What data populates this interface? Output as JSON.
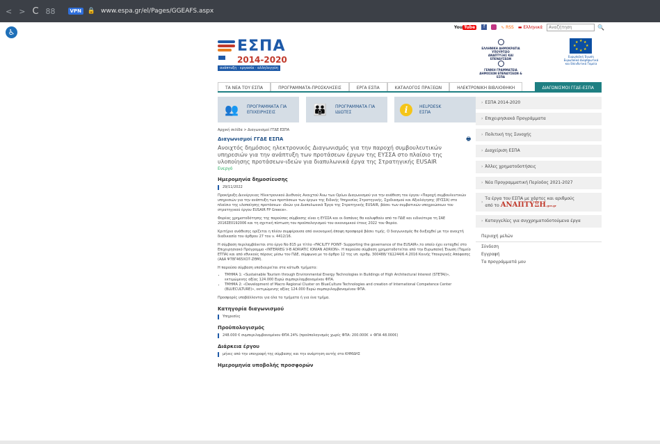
{
  "browser": {
    "back": "<",
    "forward": ">",
    "reload": "C",
    "apps": "88",
    "vpn": "VPN",
    "url": "www.espa.gr/el/Pages/GGEAFS.aspx"
  },
  "topbar": {
    "youtube": "You",
    "youtube_tube": "Tube",
    "rss": "RSS",
    "language": "Ελληνικά",
    "search_placeholder": "Αναζήτηση"
  },
  "logo": {
    "word": "ΕΣΠΑ",
    "years": "2014-2020",
    "tagline": "ανάπτυξη · εργασία · αλληλεγγύη"
  },
  "gov": {
    "l1": "ΕΛΛΗΝΙΚΗ ΔΗΜΟΚΡΑΤΙΑ",
    "l2": "ΥΠΟΥΡΓΕΙΟ",
    "l3": "ΑΝΑΠΤΥΞΗΣ ΚΑΙ ΕΠΕΝΔΥΣΕΩΝ",
    "l4": "ΓΕΝΙΚΗ ΓΡΑΜΜΑΤΕΙΑ",
    "l5": "ΔΗΜΟΣΙΩΝ ΕΠΕΝΔΥΣΕΩΝ & ΕΣΠΑ"
  },
  "eu": {
    "l1": "Ευρωπαϊκή Ένωση",
    "l2": "Ευρωπαϊκά Διαρθρωτικά",
    "l3": "και Επενδυτικά Ταμεία"
  },
  "menu": [
    "ΤΑ ΝΕΑ ΤΟΥ ΕΣΠΑ",
    "ΠΡΟΓΡΑΜΜΑΤΑ-ΠΡΟΣΚΛΗΣΕΙΣ",
    "ΕΡΓΑ ΕΣΠΑ",
    "ΚΑΤΑΛΟΓΟΣ ΠΡΑΞΕΩΝ",
    "ΗΛΕΚΤΡΟΝΙΚΗ ΒΙΒΛΙΟΘΗΚΗ",
    "ΔΙΑΓΩΝΙΣΜΟΙ ΓΓΔΕ-ΕΣΠΑ"
  ],
  "tiles": [
    {
      "line1": "ΠΡΟΓΡΑΜΜΑΤΑ ΓΙΑ",
      "line2": "ΕΠΙΧΕΙΡΗΣΕΙΣ"
    },
    {
      "line1": "ΠΡΟΓΡΑΜΜΑΤΑ ΓΙΑ",
      "line2": "ΙΔΙΩΤΕΣ"
    },
    {
      "line1": "HELPDESK",
      "line2": "ΕΣΠΑ",
      "icon": "i"
    }
  ],
  "sidebar": {
    "items": [
      "ΕΣΠΑ 2014-2020",
      "Επιχειρησιακά Προγράμματα",
      "Πολιτική της Συνοχής",
      "Διαχείριση ΕΣΠΑ",
      "Άλλες χρηματοδοτήσεις",
      "Νέα Προγραμματική Περίοδος 2021-2027"
    ],
    "tall_line1": "Τα έργα του ΕΣΠΑ με χάρτες και αριθμούς",
    "tall_line2_prefix": "από το",
    "tall_brand": "ΑΝΑΠΤΥΞΗ",
    "tall_brand_suffix": ".gov.gr",
    "last": "Καταγγελίες για συγχρηματοδοτούμενα έργα",
    "user_header": "Περιοχή μελών",
    "user_links": [
      "Σύνδεση",
      "Εγγραφή",
      "Τα προγράμματά μου"
    ]
  },
  "content": {
    "breadcrumb": "Αρχική σελίδα > Διαγωνισμοί ΓΓΔΕ ΕΣΠΑ",
    "title": "Διαγωνισμοί ΓΓΔΕ ΕΣΠΑ",
    "print": "🖶",
    "lead": "Ανοιχτός δημόσιος ηλεκτρονικός Διαγωνισμός για την παροχή συμβουλευτικών υπηρεσιών για την ανάπτυξη των προτάσεων έργων της ΕΥΣΣΑ στο πλαίσιο της υλοποίησης προτάσεων-ιδεών για διαπυλωνικά έργα της Στρατηγικής EUSAIR",
    "status": "Ενεργό",
    "date_header": "Ημερομηνία δημοσίευσης",
    "date": "29/11/2022",
    "p1": "Προκήρυξη Διενέργειας Ηλεκτρονικού Διεθνούς Ανοιχτού Άνω των Ορίων Διαγωνισμού για την ανάθεση του έργου «Παροχή συμβουλευτικών υπηρεσιών για την ανάπτυξη των προτάσεων των έργων της Ειδικής Υπηρεσίας Στρατηγικής, Σχεδιασμού και Αξιολόγησης (ΕΥΣΣΑ) στο πλαίσιο της υλοποίησης προτάσεων- ιδεών για Διαπυλωνικά Έργα της Στρατηγικής EUSAIR, βάσει των συμβατικών υποχρεώσεων του στρατηγικού έργου EUSAIR FP Greece».",
    "p2": "Φορέας χρηματοδότησης της παρούσας σύμβασης είναι η ΕΥΣΣΑ και οι δαπάνες θα καλυφθούν από το ΠΔΕ και ειδικότερα τη ΣΑΕ 2016ΣΕ0192006 και τη σχετική πίστωση του προϋπολογισμού του οικονομικού έτους 2022 του Φορέα.",
    "p3": "Κριτήριο ανάθεσης ορίζεται η πλέον συμφέρουσα από οικονομική άποψη προσφορά βάσει τιμής. Ο διαγωνισμός θα διεξαχθεί με την ανοιχτή διαδικασία του άρθρου 27 του ν. 4412/16.",
    "p4": "Η σύμβαση περιλαμβάνεται στο έργο Νο 815 με τίτλο «FACILITY POINT- Supporting the governance of the EUSAIR»,το οποίο έχει ενταχθεί στο Επιχειρησιακό Πρόγραμμα «INTERREG V-B ADRIATIC IONIAN ADRION». Η παρούσα σύμβαση χρηματοδοτείται από την Ευρωπαϊκή Ένωση (Ταμείο ΕΤΠΑ) και από εθνικούς πόρους μέσω του ΠΔΕ, σύμφωνα με το άρθρο 12 της υπ. αριθμ. 300488/ ΥΔ1244/6.4.2016 Κοινής Υπουργικής Απόφασης (ΑΔΑ Ψ78Γ465ΧΟ7-ΖΘΜ).",
    "p5": "Η παρούσα σύμβαση υποδιαιρείται στα κάτωθι τμήματα:",
    "bullets": [
      "ΤΜΗΜΑ 1: «Sustainable Tourism through Environmental Energy Technologies in Buildings of High Architectural Interest (STETAI)», εκτιμώμενης αξίας 124.000 Ευρώ συμπεριλαμβανομένου ΦΠΑ.",
      "ΤΜΗΜΑ 2: «Development of Macro Regional Cluster on BlueCulture Technologies and creation of International Competence Center (BLUECULTURE)», εκτιμώμενης αξίας 124.000 Ευρώ συμπεριλαμβανομένου ΦΠΑ."
    ],
    "p6": "Προσφορές υποβάλλονται για όλα τα τμήματα ή για ένα τμήμα.",
    "cat_header": "Κατηγορία διαγωνισμού",
    "cat": "Υπηρεσίες",
    "budget_header": "Προϋπολογισμός",
    "budget": "248.000 € συμπεριλαμβανομένου ΦΠΑ 24% (προϋπολογισμός χωρίς ΦΠΑ: 200.000€ + ΦΠΑ 48.000€)",
    "duration_header": "Διάρκεια έργου",
    "duration": "μήνες από την υπογραφή της σύμβασης και την ανάρτηση αυτής στο ΚΗΜΔΗΣ",
    "cutoff": "Ημερομηνία υποβολής προσφορών"
  }
}
